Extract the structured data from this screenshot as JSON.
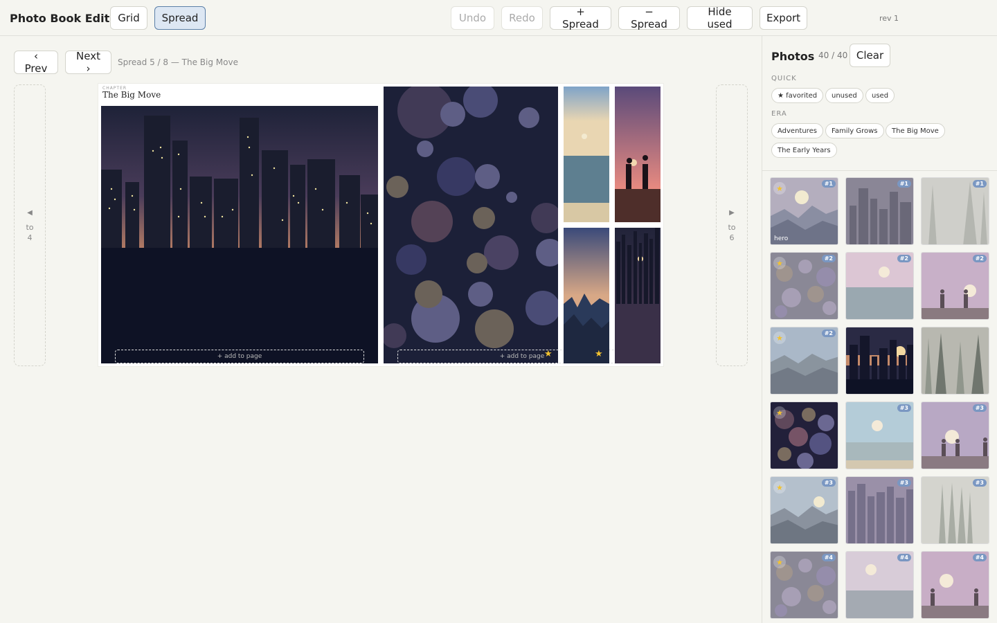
{
  "app": {
    "title": "Photo Book Editor",
    "rev": "rev 1"
  },
  "toolbar": {
    "grid": "Grid",
    "spread": "Spread",
    "undo": "Undo",
    "redo": "Redo",
    "add_spread": "+ Spread",
    "remove_spread": "− Spread",
    "hide_used": "Hide used",
    "export": "Export"
  },
  "nav": {
    "prev": "‹ Prev",
    "next": "Next ›",
    "info": "Spread 5 / 8 — The Big Move",
    "left_arrow": "◀",
    "left_to": "to",
    "left_num": "4",
    "right_arrow": "▶",
    "right_to": "to",
    "right_num": "6"
  },
  "spread": {
    "chapter_kicker": "CHAPTER",
    "chapter_title": "The Big Move",
    "add_label": "+ add to page",
    "star": "★"
  },
  "photos": {
    "title": "Photos",
    "count": "40 / 40",
    "clear": "Clear",
    "quick_label": "QUICK",
    "quick": [
      "★ favorited",
      "unused",
      "used"
    ],
    "era_label": "ERA",
    "eras": [
      "Adventures",
      "Family Grows",
      "The Big Move",
      "The Early Years"
    ],
    "hero_label": "hero",
    "thumbs": [
      {
        "kind": "mountain",
        "star": true,
        "badge": "#1",
        "hero": true
      },
      {
        "kind": "city",
        "star": false,
        "badge": "#1",
        "hero": false
      },
      {
        "kind": "forest",
        "star": false,
        "badge": "#1",
        "hero": false
      },
      {
        "kind": "bokeh",
        "star": true,
        "badge": "#2",
        "hero": false
      },
      {
        "kind": "sea",
        "star": false,
        "badge": "#2",
        "hero": false
      },
      {
        "kind": "couple",
        "star": false,
        "badge": "#2",
        "hero": false
      },
      {
        "kind": "mountain2",
        "star": true,
        "badge": "#2",
        "hero": false
      },
      {
        "kind": "citydark",
        "star": false,
        "badge": "",
        "hero": false
      },
      {
        "kind": "forest2",
        "star": false,
        "badge": "",
        "hero": false
      },
      {
        "kind": "bokehdark",
        "star": true,
        "badge": "",
        "hero": false
      },
      {
        "kind": "sea2",
        "star": false,
        "badge": "#3",
        "hero": false
      },
      {
        "kind": "family",
        "star": false,
        "badge": "#3",
        "hero": false
      },
      {
        "kind": "mountain3",
        "star": true,
        "badge": "#3",
        "hero": false
      },
      {
        "kind": "city2",
        "star": false,
        "badge": "#3",
        "hero": false
      },
      {
        "kind": "forest3",
        "star": false,
        "badge": "#3",
        "hero": false
      },
      {
        "kind": "bokeh",
        "star": true,
        "badge": "#4",
        "hero": false
      },
      {
        "kind": "sea3",
        "star": false,
        "badge": "#4",
        "hero": false
      },
      {
        "kind": "couple2",
        "star": false,
        "badge": "#4",
        "hero": false
      }
    ]
  }
}
